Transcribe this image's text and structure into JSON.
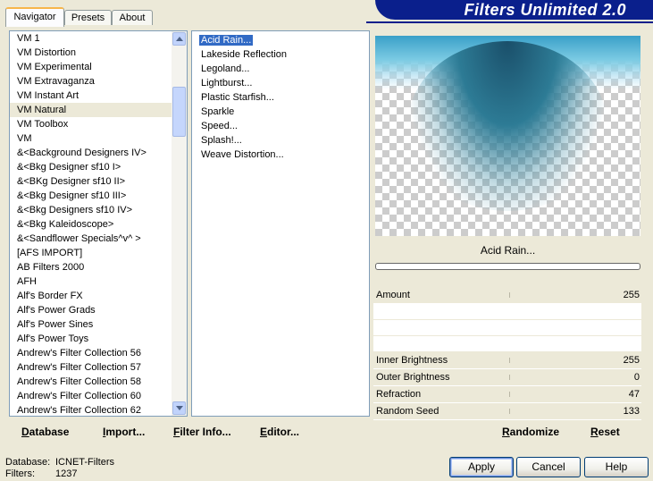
{
  "tabs": [
    {
      "label": "Navigator",
      "active": true
    },
    {
      "label": "Presets",
      "active": false
    },
    {
      "label": "About",
      "active": false
    }
  ],
  "banner": {
    "title": "Filters Unlimited 2.0"
  },
  "categories": {
    "selected_index": 5,
    "items": [
      "VM 1",
      "VM Distortion",
      "VM Experimental",
      "VM Extravaganza",
      "VM Instant Art",
      "VM Natural",
      "VM Toolbox",
      "VM",
      "&<Background Designers IV>",
      "&<Bkg Designer sf10 I>",
      "&<BKg Designer sf10 II>",
      "&<Bkg Designer sf10 III>",
      "&<Bkg Designers sf10 IV>",
      "&<Bkg Kaleidoscope>",
      "&<Sandflower Specials^v^ >",
      "[AFS IMPORT]",
      "AB Filters 2000",
      "AFH",
      "Alf's Border FX",
      "Alf's Power Grads",
      "Alf's Power Sines",
      "Alf's Power Toys",
      "Andrew's Filter Collection 56",
      "Andrew's Filter Collection 57",
      "Andrew's Filter Collection 58",
      "Andrew's Filter Collection 60",
      "Andrew's Filter Collection 62"
    ]
  },
  "filters": {
    "selected_index": 0,
    "items": [
      "Acid Rain...",
      "Lakeside Reflection",
      "Legoland...",
      "Lightburst...",
      "Plastic Starfish...",
      "Sparkle",
      "Speed...",
      "Splash!...",
      "Weave Distortion..."
    ]
  },
  "preview": {
    "filter_name": "Acid Rain..."
  },
  "params": [
    {
      "label": "Amount",
      "value": "255"
    },
    {
      "label": "",
      "value": ""
    },
    {
      "label": "",
      "value": ""
    },
    {
      "label": "",
      "value": ""
    },
    {
      "label": "Inner Brightness",
      "value": "255"
    },
    {
      "label": "Outer Brightness",
      "value": "0"
    },
    {
      "label": "Refraction",
      "value": "47"
    },
    {
      "label": "Random Seed",
      "value": "133"
    }
  ],
  "left_buttons": {
    "database": "Database",
    "import": "Import...",
    "filter_info": "Filter Info...",
    "editor": "Editor..."
  },
  "right_buttons": {
    "randomize": "Randomize",
    "reset": "Reset"
  },
  "status": {
    "database_label": "Database:",
    "database_value": "ICNET-Filters",
    "filters_label": "Filters:",
    "filters_value": "1237"
  },
  "dialog_buttons": {
    "apply": "Apply",
    "cancel": "Cancel",
    "help": "Help"
  },
  "colors": {
    "banner": "#0a1f8c",
    "selection": "#316ac5",
    "dialog_bg": "#ece9d8"
  }
}
